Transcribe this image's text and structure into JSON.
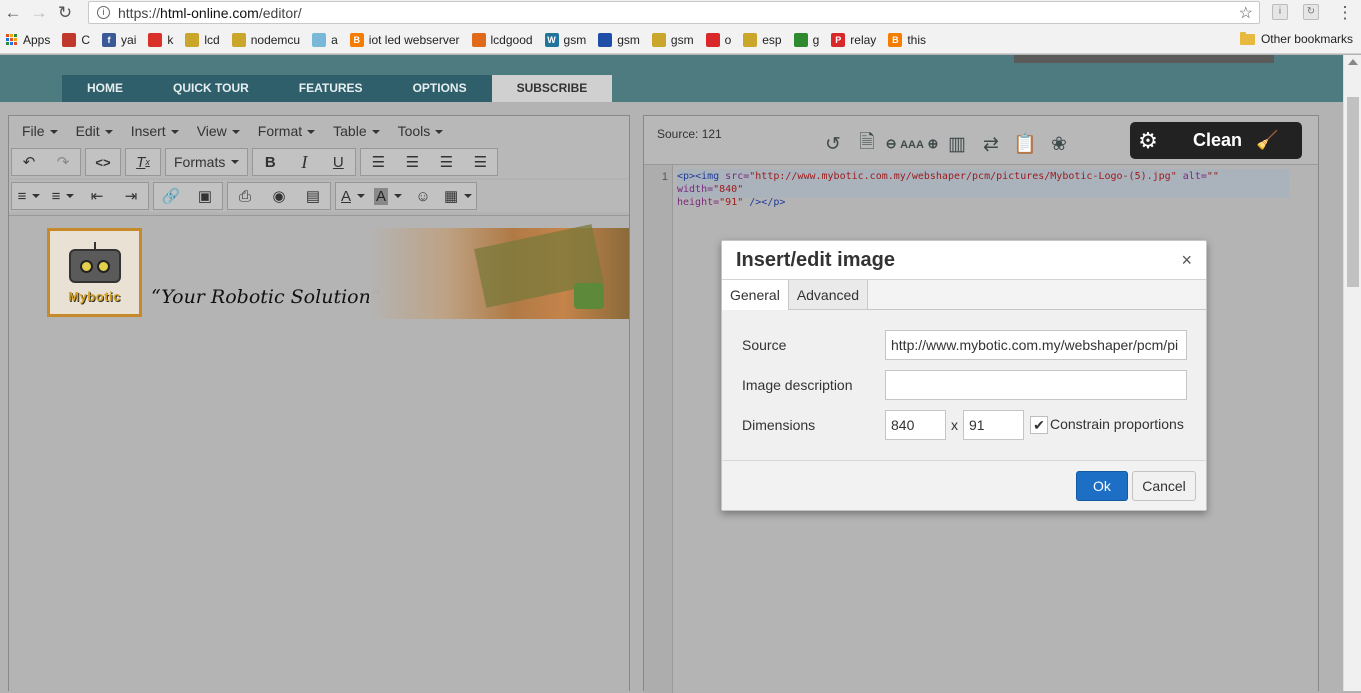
{
  "browser": {
    "url_scheme": "https://",
    "url_host": "html-online.com",
    "url_path": "/editor/",
    "bookmarks": [
      {
        "label": "Apps",
        "color": "#e44d26"
      },
      {
        "label": "C",
        "color": "#c0392b"
      },
      {
        "label": "yai",
        "color": "#3b5998"
      },
      {
        "label": "k",
        "color": "#d9302a"
      },
      {
        "label": "lcd",
        "color": "#caa62a"
      },
      {
        "label": "nodemcu",
        "color": "#caa62a"
      },
      {
        "label": "a",
        "color": "#7ab8d8"
      },
      {
        "label": "iot led webserver",
        "color": "#f57d00"
      },
      {
        "label": "lcdgood",
        "color": "#e06a1a"
      },
      {
        "label": "gsm",
        "color": "#21759b"
      },
      {
        "label": "gsm",
        "color": "#1f4ea8"
      },
      {
        "label": "gsm",
        "color": "#caa62a"
      },
      {
        "label": "o",
        "color": "#d8282a"
      },
      {
        "label": "esp",
        "color": "#caa62a"
      },
      {
        "label": "g",
        "color": "#2d8a2d"
      },
      {
        "label": "relay",
        "color": "#d8282a"
      },
      {
        "label": "this",
        "color": "#f57d00"
      }
    ],
    "other_bookmarks": "Other bookmarks"
  },
  "site_nav": [
    "HOME",
    "QUICK TOUR",
    "FEATURES",
    "OPTIONS",
    "SUBSCRIBE"
  ],
  "editor": {
    "menus": [
      "File",
      "Edit",
      "Insert",
      "View",
      "Format",
      "Table",
      "Tools"
    ],
    "formats_label": "Formats",
    "logo_word": "Mybotic",
    "tagline": "“Your Robotic Solution”"
  },
  "source": {
    "count_label": "Source: 121",
    "font_size_label": "AAA",
    "clean_label": "Clean",
    "line_number": "1",
    "code": {
      "p_open": "<p>",
      "img_open": "<img ",
      "src_attr": "src=",
      "src_val": "\"http://www.mybotic.com.my/webshaper/pcm/pictures/Mybotic-Logo-(5).jpg\"",
      "alt_attr": " alt=",
      "alt_val": "\"\"",
      "width_attr": " width=",
      "width_val": "\"840\"",
      "height_attr": "height=",
      "height_val": "\"91\"",
      "close": " /></p>"
    }
  },
  "dialog": {
    "title": "Insert/edit image",
    "close_glyph": "×",
    "tabs": [
      "General",
      "Advanced"
    ],
    "source_label": "Source",
    "source_value": "http://www.mybotic.com.my/webshaper/pcm/pi",
    "description_label": "Image description",
    "description_value": "",
    "dimensions_label": "Dimensions",
    "width_value": "840",
    "dim_separator": "x",
    "height_value": "91",
    "constrain_label": "Constrain proportions",
    "constrain_checked": true,
    "ok_label": "Ok",
    "cancel_label": "Cancel"
  }
}
